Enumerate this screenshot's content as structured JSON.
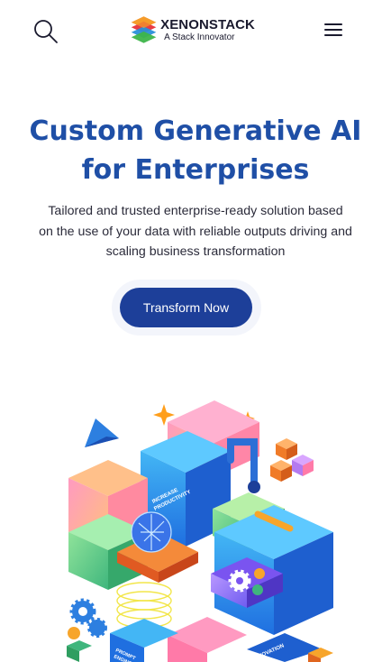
{
  "header": {
    "logo_name": "XENONSTACK",
    "logo_tagline": "A Stack Innovator",
    "search_icon": "search-icon",
    "menu_icon": "hamburger-menu-icon"
  },
  "hero": {
    "title_line1": "Custom Generative AI",
    "title_line2": "for Enterprises",
    "description_line1": "Tailored and trusted enterprise-ready solution based",
    "description_line2": "on the use of your data with reliable outputs driving and",
    "description_line3": "scaling business transformation",
    "cta_label": "Transform Now"
  },
  "illustration": {
    "label_productivity_1": "INCREASE",
    "label_productivity_2": "PRODUCTIVITY",
    "label_prompt_1": "PROMPT",
    "label_prompt_2": "ENGINEERING",
    "label_innovation": "INNOVATION"
  },
  "colors": {
    "title": "#1f4fa6",
    "cta_background": "#1d3f99",
    "cta_text": "#ffffff",
    "body_text": "#2b2b3a"
  }
}
